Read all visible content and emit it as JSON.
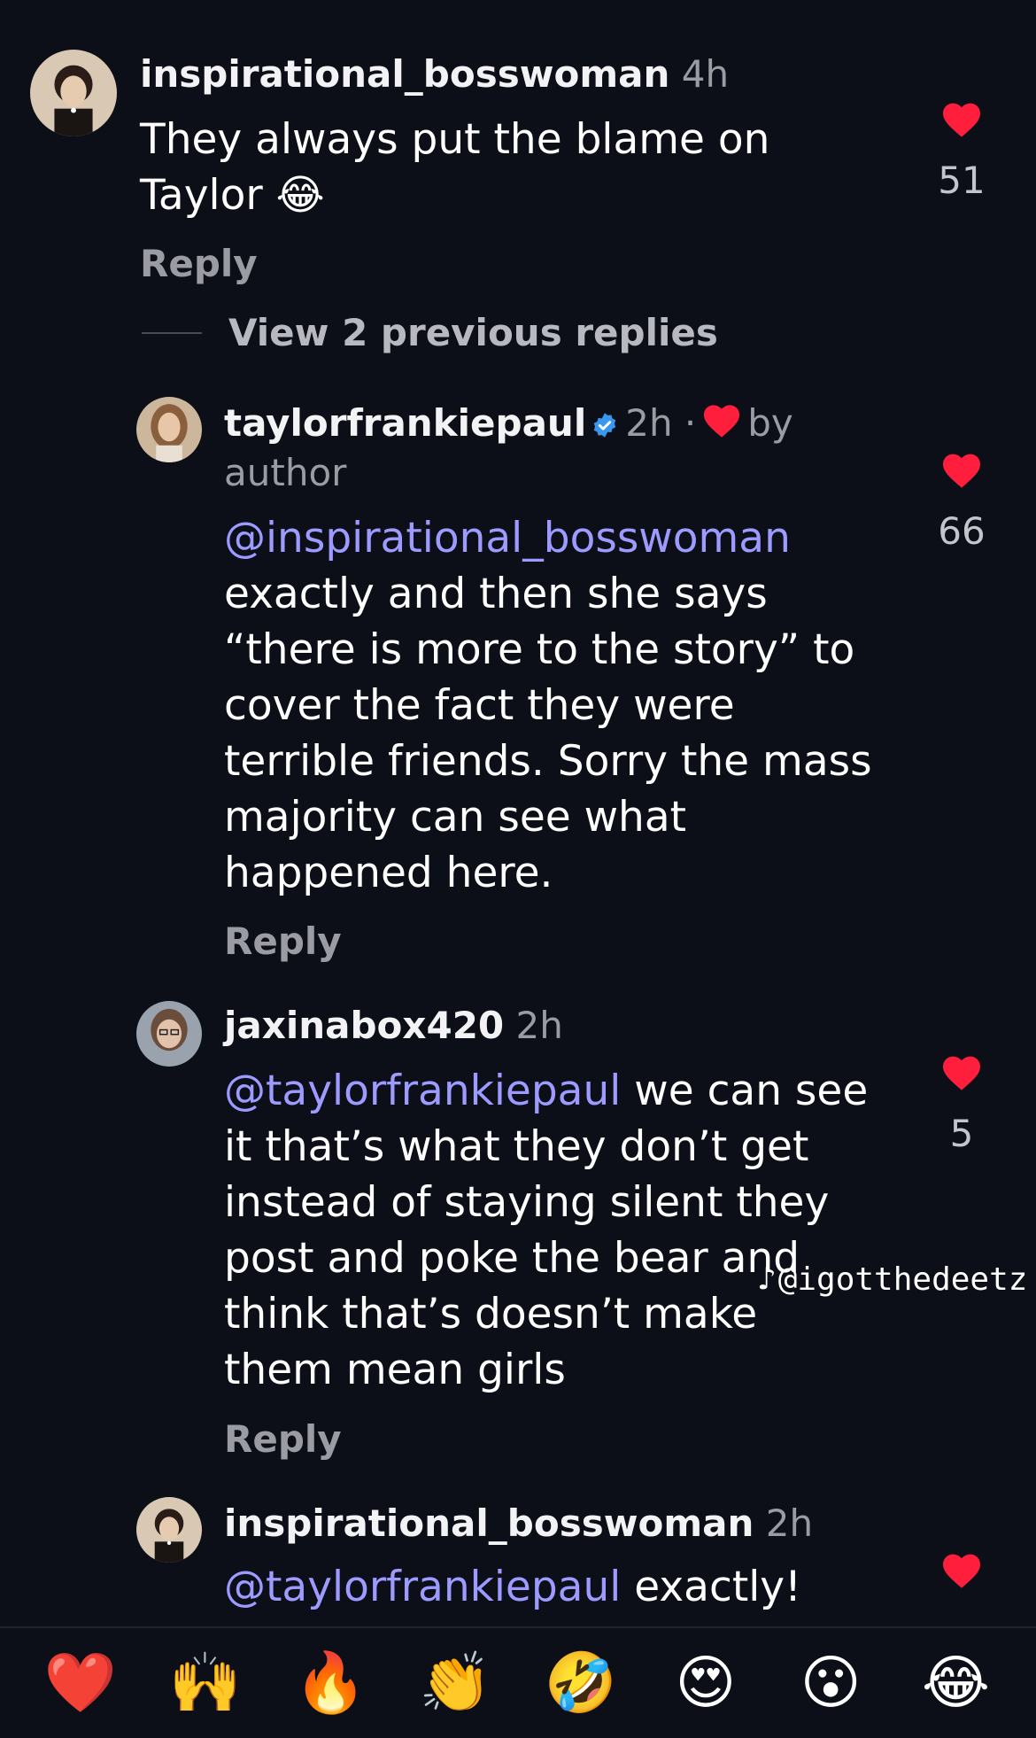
{
  "comments": [
    {
      "username": "inspirational_bosswoman",
      "time": "4h",
      "body_lines": [
        "They always put the blame on",
        "Taylor 😂"
      ],
      "reply_label": "Reply",
      "likes": "51"
    },
    {
      "username": "taylorfrankiepaul",
      "time": "2h ·",
      "by_text": "by",
      "author_text": "author",
      "mention": "@inspirational_bosswoman",
      "body_lines": [
        "exactly and then she says",
        "“there is more to the story” to",
        "cover the fact they were",
        "terrible friends. Sorry the mass",
        "majority can see what",
        "happened here."
      ],
      "reply_label": "Reply",
      "likes": "66"
    },
    {
      "username": "jaxinabox420",
      "time": "2h",
      "mention": "@taylorfrankiepaul",
      "first_line_rest": " we can see",
      "body_lines": [
        "it that’s what they don’t get",
        "instead of staying silent they",
        "post and poke the bear and",
        "think that’s doesn’t make",
        "them mean girls"
      ],
      "reply_label": "Reply",
      "likes": "5"
    },
    {
      "username": "inspirational_bosswoman",
      "time": "2h",
      "mention": "@taylorfrankiepaul",
      "first_line_rest": " exactly!"
    }
  ],
  "view_replies_label": "View 2 previous replies",
  "watermark": {
    "icon": "tiktok-note-icon",
    "text": "@igotthedeetz"
  },
  "reactions": [
    "❤️",
    "🙌",
    "🔥",
    "👏",
    "🤣",
    "😍",
    "😮",
    "😂"
  ],
  "colors": {
    "background": "#0c0f17",
    "like_heart": "#ff1f3d",
    "mention": "#9d9bff",
    "muted": "#9b9ca3",
    "verified": "#3897f0"
  }
}
